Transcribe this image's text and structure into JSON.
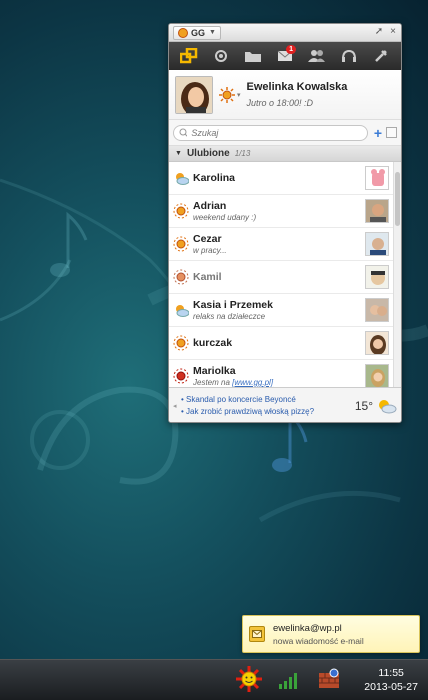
{
  "window": {
    "menu_label": "GG",
    "close_glyph": "×",
    "pin_glyph": "✕"
  },
  "toolbar": {
    "unread_count": "1"
  },
  "profile": {
    "name": "Ewelinka Kowalska",
    "description": "Jutro o 18:00! :D"
  },
  "search": {
    "placeholder": "Szukaj"
  },
  "group": {
    "name": "Ulubione",
    "count": "1/13"
  },
  "contacts": [
    {
      "name": "Karolina",
      "desc": "",
      "status": "away-cloud"
    },
    {
      "name": "Adrian",
      "desc": "weekend udany :)",
      "status": "available"
    },
    {
      "name": "Cezar",
      "desc": "w pracy...",
      "status": "available"
    },
    {
      "name": "Kamil",
      "desc": "",
      "status": "offline-gray"
    },
    {
      "name": "Kasia i Przemek",
      "desc": "relaks na działeczce",
      "status": "away-cloud"
    },
    {
      "name": "kurczak",
      "desc": "",
      "status": "available"
    },
    {
      "name": "Mariolka",
      "desc_prefix": "Jestem na ",
      "desc_link": "[www.gg.pl]",
      "status": "busy-red"
    }
  ],
  "news": [
    "Skandal po koncercie Beyoncé",
    "Jak zrobić prawdziwą włoską pizzę?"
  ],
  "weather": {
    "temperature": "15°"
  },
  "notification": {
    "title": "ewelinka@wp.pl",
    "subtitle": "nowa wiadomość e-mail"
  },
  "taskbar": {
    "time": "11:55",
    "date": "2013-05-27"
  },
  "colors": {
    "accent": "#f0a020",
    "link": "#2a5cad",
    "desktop": "#14505e"
  }
}
